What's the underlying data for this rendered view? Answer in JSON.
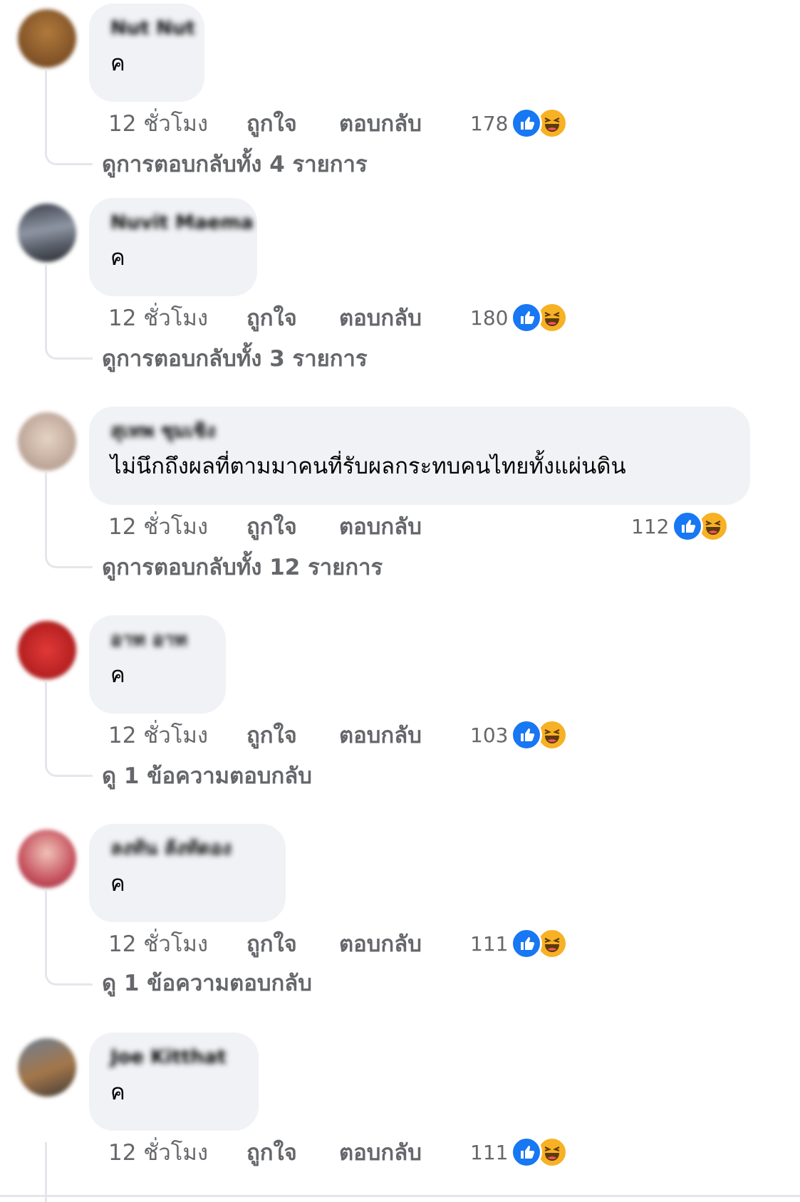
{
  "ui": {
    "like_label": "ถูกใจ",
    "reply_label": "ตอบกลับ"
  },
  "colors": {
    "bubble": "#f0f2f5",
    "secondary_text": "#65676b",
    "like_blue": "#1877f2",
    "haha_yellow": "#f7b125"
  },
  "comments": [
    {
      "author": "Nut Nut",
      "text": "ค",
      "time": "12 ชั่วโมง",
      "reaction_count": "178",
      "reactions": [
        "like-icon",
        "haha-icon"
      ],
      "view_replies": "ดูการตอบกลับทั้ง 4 รายการ"
    },
    {
      "author": "Nuvit Maema",
      "text": "ค",
      "time": "12 ชั่วโมง",
      "reaction_count": "180",
      "reactions": [
        "like-icon",
        "haha-icon"
      ],
      "view_replies": "ดูการตอบกลับทั้ง 3 รายการ"
    },
    {
      "author": "สุเทพ ชุมเชิง",
      "text": "ไม่นึกถึงผลที่ตามมาคนที่รับผลกระทบคนไทยทั้งแผ่นดิน",
      "time": "12 ชั่วโมง",
      "reaction_count": "112",
      "reactions": [
        "like-icon",
        "haha-icon"
      ],
      "view_replies": "ดูการตอบกลับทั้ง 12 รายการ"
    },
    {
      "author": "อาท อาท",
      "text": "ค",
      "time": "12 ชั่วโมง",
      "reaction_count": "103",
      "reactions": [
        "like-icon",
        "haha-icon"
      ],
      "view_replies": "ดู 1 ข้อความตอบกลับ"
    },
    {
      "author": "ลงทัน ลังทัดอง",
      "text": "ค",
      "time": "12 ชั่วโมง",
      "reaction_count": "111",
      "reactions": [
        "like-icon",
        "haha-icon"
      ],
      "view_replies": "ดู 1 ข้อความตอบกลับ"
    },
    {
      "author": "Joe Kitthat",
      "text": "ค",
      "time": "12 ชั่วโมง",
      "reaction_count": "111",
      "reactions": [
        "like-icon",
        "haha-icon"
      ],
      "view_replies": ""
    }
  ]
}
